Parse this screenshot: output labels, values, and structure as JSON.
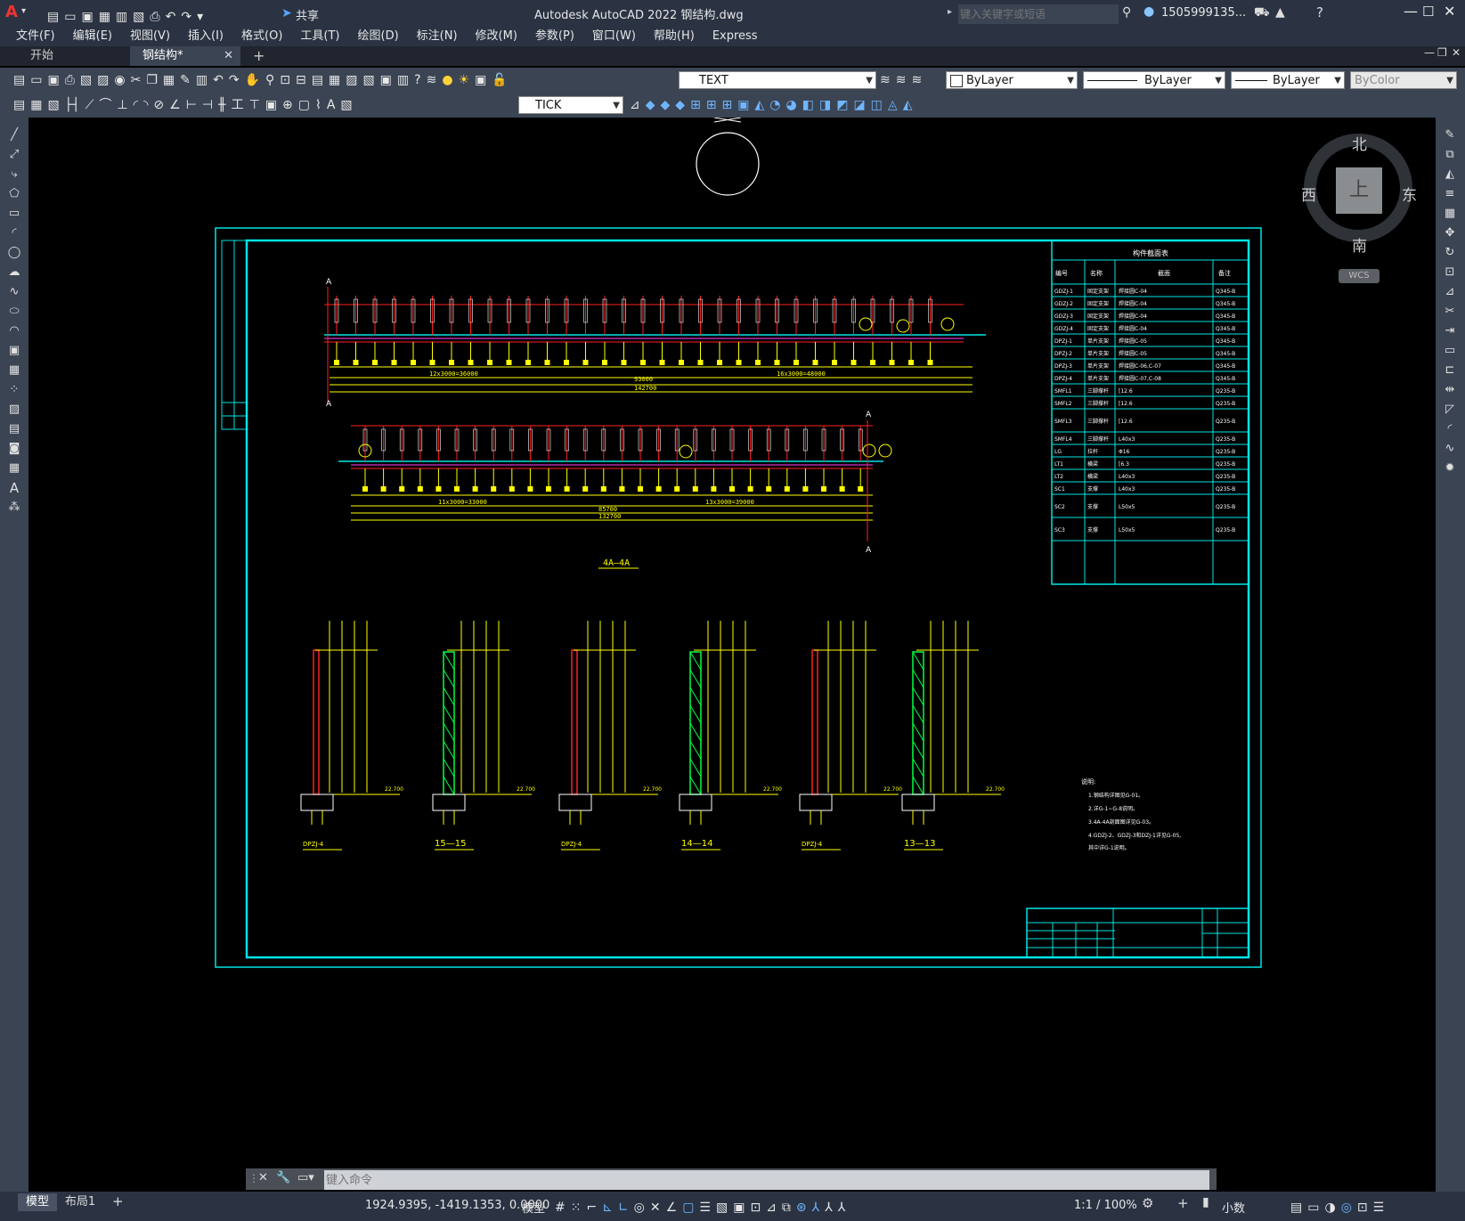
{
  "window": {
    "title": "Autodesk AutoCAD 2022    钢结构.dwg",
    "share_label": "共享",
    "search_placeholder": "键入关键字或短语",
    "user": "1505999135...",
    "app_letter": "A"
  },
  "menu": [
    "文件(F)",
    "编辑(E)",
    "视图(V)",
    "插入(I)",
    "格式(O)",
    "工具(T)",
    "绘图(D)",
    "标注(N)",
    "修改(M)",
    "参数(P)",
    "窗口(W)",
    "帮助(H)",
    "Express"
  ],
  "tabs": [
    {
      "label": "开始",
      "active": false
    },
    {
      "label": "钢结构*",
      "active": true
    }
  ],
  "toolbar1": {
    "layer_value": "TEXT",
    "color_value": "ByLayer",
    "linetype_value": "ByLayer",
    "lineweight_value": "ByLayer",
    "plotstyle_value": "ByColor"
  },
  "toolbar2": {
    "dimstyle_value": "TICK"
  },
  "viewcube": {
    "north": "北",
    "south": "南",
    "east": "东",
    "west": "西",
    "top": "上",
    "wcs": "WCS"
  },
  "drawing": {
    "section_label": "4A—4A",
    "sections": [
      "15—15",
      "14—14",
      "13—13"
    ],
    "part_labels": [
      "DPZJ-4",
      "DPZJ-4",
      "DPZJ-4"
    ],
    "table_title": "构件截面表",
    "table_header": [
      "编号",
      "名称",
      "截面",
      "备注"
    ],
    "table_rows": [
      [
        "GDZJ-1",
        "固定支架",
        "焊接圆C-04",
        "Q345-B"
      ],
      [
        "GDZJ-2",
        "固定支架",
        "焊接圆C-04",
        "Q345-B"
      ],
      [
        "GDZJ-3",
        "固定支架",
        "焊接圆C-04",
        "Q345-B"
      ],
      [
        "GDZJ-4",
        "固定支架",
        "焊接圆C-04",
        "Q345-B"
      ],
      [
        "DPZJ-1",
        "单片支架",
        "焊接圆C-05",
        "Q345-B"
      ],
      [
        "DPZJ-2",
        "单片支架",
        "焊接圆C-05",
        "Q345-B"
      ],
      [
        "DPZJ-3",
        "单片支架",
        "焊接圆C-06,C-07",
        "Q345-B"
      ],
      [
        "DPZJ-4",
        "单片支架",
        "焊接圆C-07,C-08",
        "Q345-B"
      ],
      [
        "SMFL1",
        "三脚撑杆",
        "[12.6",
        "Q235-B"
      ],
      [
        "SMFL2",
        "三脚撑杆",
        "[12.6",
        "Q235-B"
      ],
      [
        "SMFL3",
        "三脚撑杆",
        "[12.6",
        "Q235-B"
      ],
      [
        "SMFL4",
        "三脚撑杆",
        "L40x3",
        "Q235-B"
      ],
      [
        "LG",
        "拉杆",
        "Φ16",
        "Q235-B"
      ],
      [
        "LT1",
        "横梁",
        "[6.3",
        "Q235-B"
      ],
      [
        "LT2",
        "横梁",
        "L40x3",
        "Q235-B"
      ],
      [
        "SC1",
        "支撑",
        "L40x3",
        "Q235-B"
      ],
      [
        "SC2",
        "支撑",
        "L50x5",
        "Q235-B"
      ],
      [
        "SC3",
        "支撑",
        "L50x5",
        "Q235-B"
      ]
    ],
    "notes_title": "说明:",
    "notes": [
      "1.钢结构详图见G-01。",
      "2.详G-1~G-8说明。",
      "3.4A-4A剖面图详见G-03。",
      "4.GDZJ-2、GDZJ-3和DZJ-1详见G-05,",
      "   其中详G-1说明。"
    ],
    "dims_top": [
      "12x3000=36000",
      "93000",
      "16x3000=48000",
      "142700"
    ],
    "dims_mid": [
      "11x3000=33000",
      "85700",
      "13x3000=39000",
      "132700"
    ],
    "level": "22.700"
  },
  "command": {
    "placeholder": "键入命令"
  },
  "layout_tabs": [
    "模型",
    "布局1"
  ],
  "status": {
    "coords": "1924.9395, -1419.1353, 0.0000",
    "model": "模型",
    "scale": "1:1 / 100%",
    "units": "小数"
  },
  "colors": {
    "frame": "#00e5e5",
    "yellow": "#ffff00",
    "red": "#ff2020",
    "green": "#00ff40",
    "white": "#ffffff",
    "magenta": "#ff40ff"
  }
}
